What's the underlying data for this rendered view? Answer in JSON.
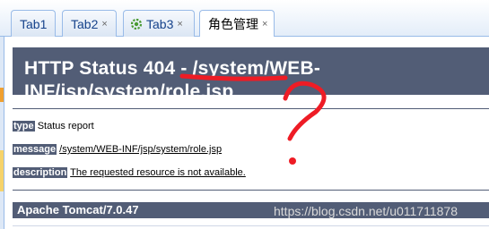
{
  "tabs": [
    {
      "label": "Tab1",
      "closable": false
    },
    {
      "label": "Tab2",
      "closable": true
    },
    {
      "label": "Tab3",
      "closable": true,
      "icon": "gear-icon"
    },
    {
      "label": "角色管理",
      "closable": true,
      "active": true
    }
  ],
  "close_glyph": "×",
  "page": {
    "heading": "HTTP Status 404 - /system/WEB-INF/jsp/system/role.jsp",
    "type_label": "type",
    "type_value": "Status report",
    "message_label": "message",
    "message_value": "/system/WEB-INF/jsp/system/role.jsp",
    "description_label": "description",
    "description_value": "The requested resource is not available.",
    "footer": "Apache Tomcat/7.0.47"
  },
  "watermark": "https://blog.csdn.net/u011711878",
  "colors": {
    "header_bg": "#525d76",
    "tab_border": "#99bbe8",
    "annotation": "#ee1c25"
  }
}
